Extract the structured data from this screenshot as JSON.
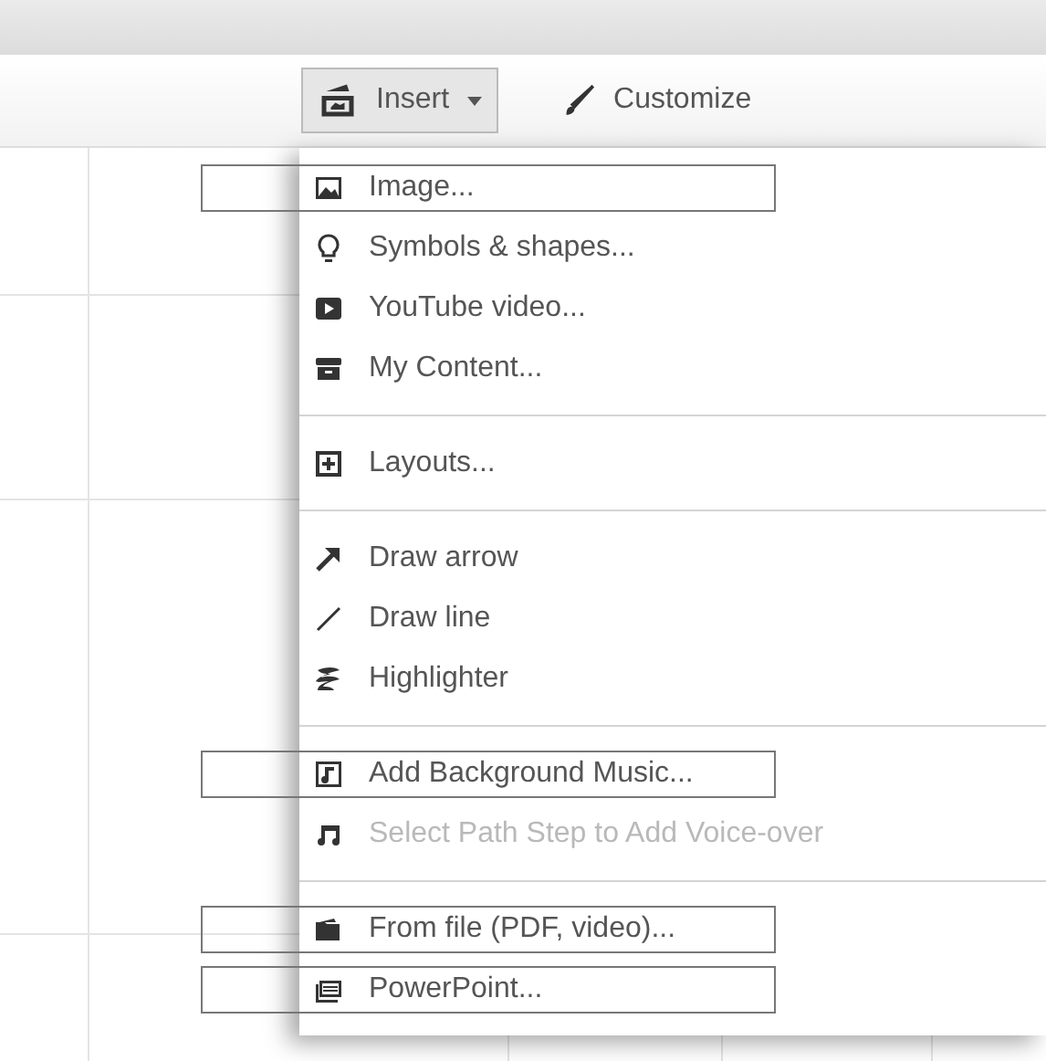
{
  "toolbar": [
    {
      "label": "Insert",
      "dropdown": true,
      "pressed": true
    },
    {
      "label": "Customize",
      "dropdown": false,
      "pressed": false
    }
  ],
  "menu": {
    "sections": [
      {
        "items": [
          {
            "label": "Image...",
            "outlined": true,
            "disabled": false
          },
          {
            "label": "Symbols & shapes...",
            "outlined": false,
            "disabled": false
          },
          {
            "label": "YouTube video...",
            "outlined": false,
            "disabled": false
          },
          {
            "label": "My Content...",
            "outlined": false,
            "disabled": false
          }
        ]
      },
      {
        "items": [
          {
            "label": "Layouts...",
            "outlined": false,
            "disabled": false
          }
        ]
      },
      {
        "items": [
          {
            "label": "Draw arrow",
            "outlined": false,
            "disabled": false
          },
          {
            "label": "Draw line",
            "outlined": false,
            "disabled": false
          },
          {
            "label": "Highlighter",
            "outlined": false,
            "disabled": false
          }
        ]
      },
      {
        "items": [
          {
            "label": "Add Background Music...",
            "outlined": true,
            "disabled": false
          },
          {
            "label": "Select Path Step to Add Voice-over",
            "outlined": false,
            "disabled": true
          }
        ]
      },
      {
        "items": [
          {
            "label": "From file (PDF, video)...",
            "outlined": true,
            "disabled": false
          },
          {
            "label": "PowerPoint...",
            "outlined": true,
            "disabled": false
          }
        ]
      }
    ]
  }
}
